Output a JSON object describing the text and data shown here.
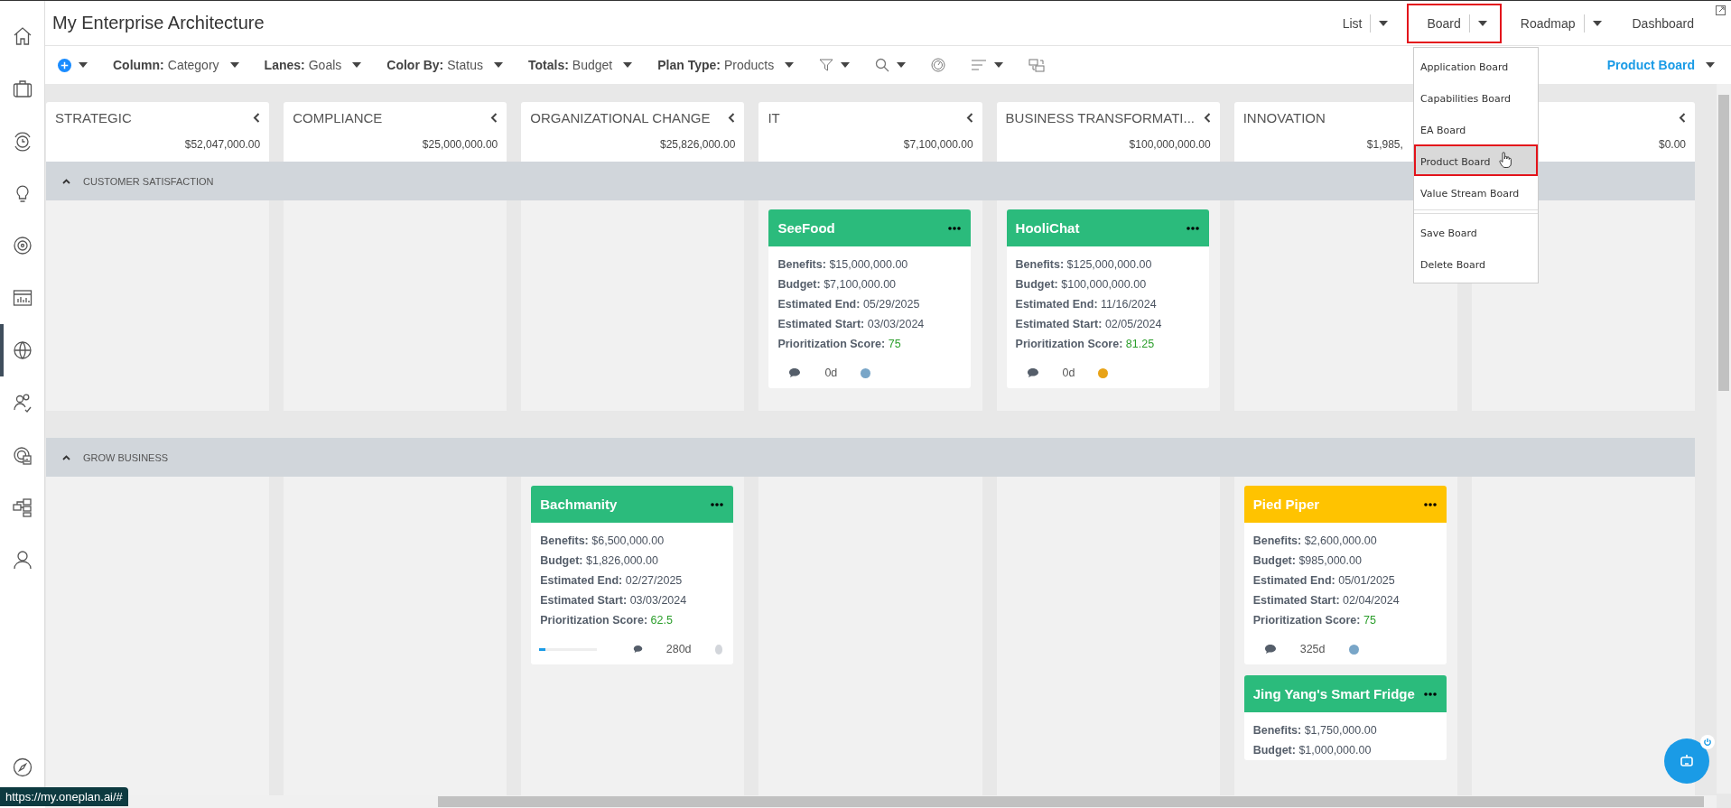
{
  "sidebar": {
    "items": [
      {
        "selected": false
      },
      {
        "selected": false
      },
      {
        "selected": false
      },
      {
        "selected": false
      },
      {
        "selected": false
      },
      {
        "selected": false
      },
      {
        "selected": true
      },
      {
        "selected": false
      },
      {
        "selected": false
      },
      {
        "selected": false
      },
      {
        "selected": false
      },
      {
        "selected": false
      }
    ]
  },
  "header": {
    "title": "My Enterprise Architecture",
    "view_tabs": [
      {
        "label": "List",
        "selected": false,
        "has_menu": true
      },
      {
        "label": "Board",
        "selected": true,
        "has_menu": true
      },
      {
        "label": "Roadmap",
        "selected": false,
        "has_menu": true
      },
      {
        "label": "Dashboard",
        "selected": false,
        "has_menu": false
      }
    ]
  },
  "toolbar": {
    "filters": [
      {
        "label": "Column:",
        "value": "Category"
      },
      {
        "label": "Lanes:",
        "value": "Goals"
      },
      {
        "label": "Color By:",
        "value": "Status"
      },
      {
        "label": "Totals:",
        "value": "Budget"
      },
      {
        "label": "Plan Type:",
        "value": "Products"
      }
    ],
    "board_selector": "Product Board"
  },
  "board_menu": {
    "items": [
      {
        "label": "Application Board",
        "selected": false
      },
      {
        "label": "Capabilities Board",
        "selected": false
      },
      {
        "label": "EA Board",
        "selected": false
      },
      {
        "label": "Product Board",
        "selected": true
      },
      {
        "label": "Value Stream Board",
        "selected": false
      }
    ],
    "actions": [
      "Save Board",
      "Delete Board"
    ]
  },
  "columns": [
    {
      "title": "STRATEGIC",
      "total": "$52,047,000.00"
    },
    {
      "title": "COMPLIANCE",
      "total": "$25,000,000.00"
    },
    {
      "title": "ORGANIZATIONAL CHANGE",
      "total": "$25,826,000.00"
    },
    {
      "title": "IT",
      "total": "$7,100,000.00"
    },
    {
      "title": "BUSINESS TRANSFORMATI...",
      "total": "$100,000,000.00"
    },
    {
      "title": "INNOVATION",
      "total": "$1,985,",
      "covered_by_menu": true
    },
    {
      "total": "$0.00"
    }
  ],
  "lanes": [
    {
      "title": "CUSTOMER SATISFACTION",
      "expanded": true,
      "cells": [
        {},
        {},
        {},
        {
          "cards": [
            {
              "title": "SeeFood",
              "color": "#2bbb7c",
              "fields": [
                {
                  "kind": "text",
                  "label": "Benefits:",
                  "value": "$15,000,000.00"
                },
                {
                  "kind": "text",
                  "label": "Budget:",
                  "value": "$7,100,000.00"
                },
                {
                  "kind": "text",
                  "label": "Estimated End:",
                  "value": "05/29/2025"
                },
                {
                  "kind": "text",
                  "label": "Estimated Start:",
                  "value": "03/03/2024"
                },
                {
                  "kind": "score",
                  "label": "Prioritization Score:",
                  "value": "75"
                }
              ],
              "footer": {
                "duration": "0d",
                "color": "#79a6c8"
              }
            }
          ]
        },
        {
          "cards": [
            {
              "title": "HooliChat",
              "color": "#2bbb7c",
              "fields": [
                {
                  "kind": "text",
                  "label": "Benefits:",
                  "value": "$125,000,000.00"
                },
                {
                  "kind": "text",
                  "label": "Budget:",
                  "value": "$100,000,000.00"
                },
                {
                  "kind": "text",
                  "label": "Estimated End:",
                  "value": "11/16/2024"
                },
                {
                  "kind": "text",
                  "label": "Estimated Start:",
                  "value": "02/05/2024"
                },
                {
                  "kind": "score",
                  "label": "Prioritization Score:",
                  "value": "81.25"
                }
              ],
              "footer": {
                "duration": "0d",
                "color": "#e8a317"
              }
            }
          ]
        },
        {},
        {}
      ]
    },
    {
      "title": "GROW BUSINESS",
      "expanded": true,
      "cells": [
        {},
        {},
        {
          "cards": [
            {
              "title": "Bachmanity",
              "color": "#2bbb7c",
              "fields": [
                {
                  "kind": "text",
                  "label": "Benefits:",
                  "value": "$6,500,000.00"
                },
                {
                  "kind": "text",
                  "label": "Budget:",
                  "value": "$1,826,000.00"
                },
                {
                  "kind": "text",
                  "label": "Estimated End:",
                  "value": "02/27/2025"
                },
                {
                  "kind": "text",
                  "label": "Estimated Start:",
                  "value": "03/03/2024"
                },
                {
                  "kind": "score",
                  "label": "Prioritization Score:",
                  "value": "62.5"
                }
              ],
              "footer": {
                "progress": {
                  "level": 0.1
                },
                "duration": "280d",
                "color": "#d3d6db"
              }
            }
          ]
        },
        {},
        {},
        {
          "cards": [
            {
              "title": "Pied Piper",
              "color": "#ffc300",
              "fields": [
                {
                  "kind": "text",
                  "label": "Benefits:",
                  "value": "$2,600,000.00"
                },
                {
                  "kind": "text",
                  "label": "Budget:",
                  "value": "$985,000.00"
                },
                {
                  "kind": "text",
                  "label": "Estimated End:",
                  "value": "05/01/2025"
                },
                {
                  "kind": "text",
                  "label": "Estimated Start:",
                  "value": "02/04/2024"
                },
                {
                  "kind": "score",
                  "label": "Prioritization Score:",
                  "value": "75"
                }
              ],
              "footer": {
                "duration": "325d",
                "color": "#79a6c8"
              }
            },
            {
              "title": "Jing Yang's Smart Fridge",
              "color": "#2bbb7c",
              "fields": [
                {
                  "kind": "text",
                  "label": "Benefits:",
                  "value": "$1,750,000.00"
                },
                {
                  "kind": "text",
                  "label": "Budget:",
                  "value": "$1,000,000.00"
                }
              ]
            }
          ]
        },
        {}
      ]
    }
  ],
  "status_url": "https://my.oneplan.ai/#"
}
